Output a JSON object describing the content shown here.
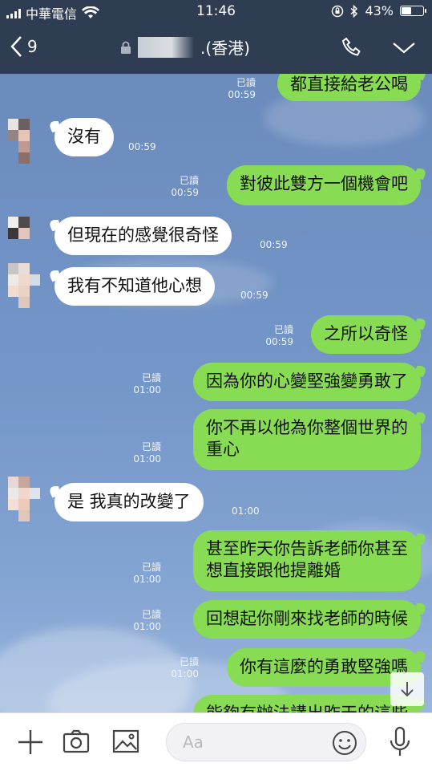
{
  "status_bar": {
    "carrier": "中華電信",
    "time": "11:46",
    "battery": "43%",
    "battery_level": 0.43
  },
  "header": {
    "back_count": "9",
    "contact_suffix": ".(香港)"
  },
  "read_label": "已讀",
  "messages": [
    {
      "side": "me",
      "text": "都直接給老公喝",
      "time": "00:59",
      "read": true
    },
    {
      "side": "them",
      "text": "沒有",
      "time": "00:59"
    },
    {
      "side": "me",
      "text": "對彼此雙方一個機會吧",
      "time": "00:59",
      "read": true
    },
    {
      "side": "them",
      "text": "但現在的感覺很奇怪",
      "time": "00:59"
    },
    {
      "side": "them",
      "text": "我有不知道他心想",
      "time": "00:59"
    },
    {
      "side": "me",
      "text": "之所以奇怪",
      "time": "00:59",
      "read": true
    },
    {
      "side": "me",
      "text": "因為你的心變堅強變勇敢了",
      "time": "01:00",
      "read": true
    },
    {
      "side": "me",
      "lines": [
        "你不再以他為你整個世界的",
        "重心"
      ],
      "time": "01:00",
      "read": true
    },
    {
      "side": "them",
      "text": "是 我真的改變了",
      "time": "01:00"
    },
    {
      "side": "me",
      "lines": [
        "甚至昨天你告訴老師你甚至",
        "想直接跟他提離婚"
      ],
      "time": "01:00",
      "read": true
    },
    {
      "side": "me",
      "text": "回想起你剛來找老師的時候",
      "time": "01:00",
      "read": true
    },
    {
      "side": "me",
      "text": "你有這麼的勇敢堅強嗎",
      "time": "01:00",
      "read": true
    },
    {
      "side": "me",
      "text": "能夠有辦法講出昨天的這些",
      "partial": true
    }
  ],
  "input": {
    "placeholder": "Aa"
  },
  "icons": {
    "status": [
      "signal-icon",
      "wifi-icon",
      "orientation-lock-icon",
      "bluetooth-icon",
      "battery-icon"
    ],
    "header": [
      "back-chevron-icon",
      "lock-icon",
      "phone-icon",
      "chevron-down-icon"
    ],
    "toolbar": [
      "plus-icon",
      "camera-icon",
      "image-icon",
      "emoji-icon",
      "microphone-icon"
    ],
    "scroll": "arrow-down-icon"
  },
  "colors": {
    "header": "#2f3d52",
    "my_bubble": "#88dc54",
    "their_bubble": "#ffffff",
    "chat_bg": "#7395c7"
  }
}
